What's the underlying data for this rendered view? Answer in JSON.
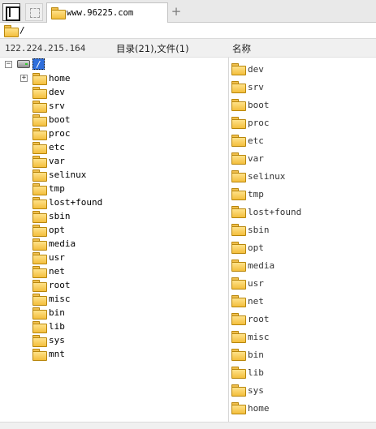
{
  "tabbar": {
    "tab_title": "www.96225.com",
    "add_tab_label": "+"
  },
  "pathbar": {
    "path": "/"
  },
  "header": {
    "server_ip": "122.224.215.164",
    "counts": "目录(21),文件(1)",
    "name_column": "名称"
  },
  "tree": {
    "root_label": "/",
    "root_expander": "−",
    "items": [
      {
        "label": "home",
        "expander": "+"
      },
      {
        "label": "dev"
      },
      {
        "label": "srv"
      },
      {
        "label": "boot"
      },
      {
        "label": "proc"
      },
      {
        "label": "etc"
      },
      {
        "label": "var"
      },
      {
        "label": "selinux"
      },
      {
        "label": "tmp"
      },
      {
        "label": "lost+found"
      },
      {
        "label": "sbin"
      },
      {
        "label": "opt"
      },
      {
        "label": "media"
      },
      {
        "label": "usr"
      },
      {
        "label": "net"
      },
      {
        "label": "root"
      },
      {
        "label": "misc"
      },
      {
        "label": "bin"
      },
      {
        "label": "lib"
      },
      {
        "label": "sys"
      },
      {
        "label": "mnt"
      }
    ]
  },
  "list": {
    "items": [
      "dev",
      "srv",
      "boot",
      "proc",
      "etc",
      "var",
      "selinux",
      "tmp",
      "lost+found",
      "sbin",
      "opt",
      "media",
      "usr",
      "net",
      "root",
      "misc",
      "bin",
      "lib",
      "sys",
      "home"
    ]
  },
  "colors": {
    "selection": "#2f6fdc",
    "folder": "#f3be3c"
  }
}
